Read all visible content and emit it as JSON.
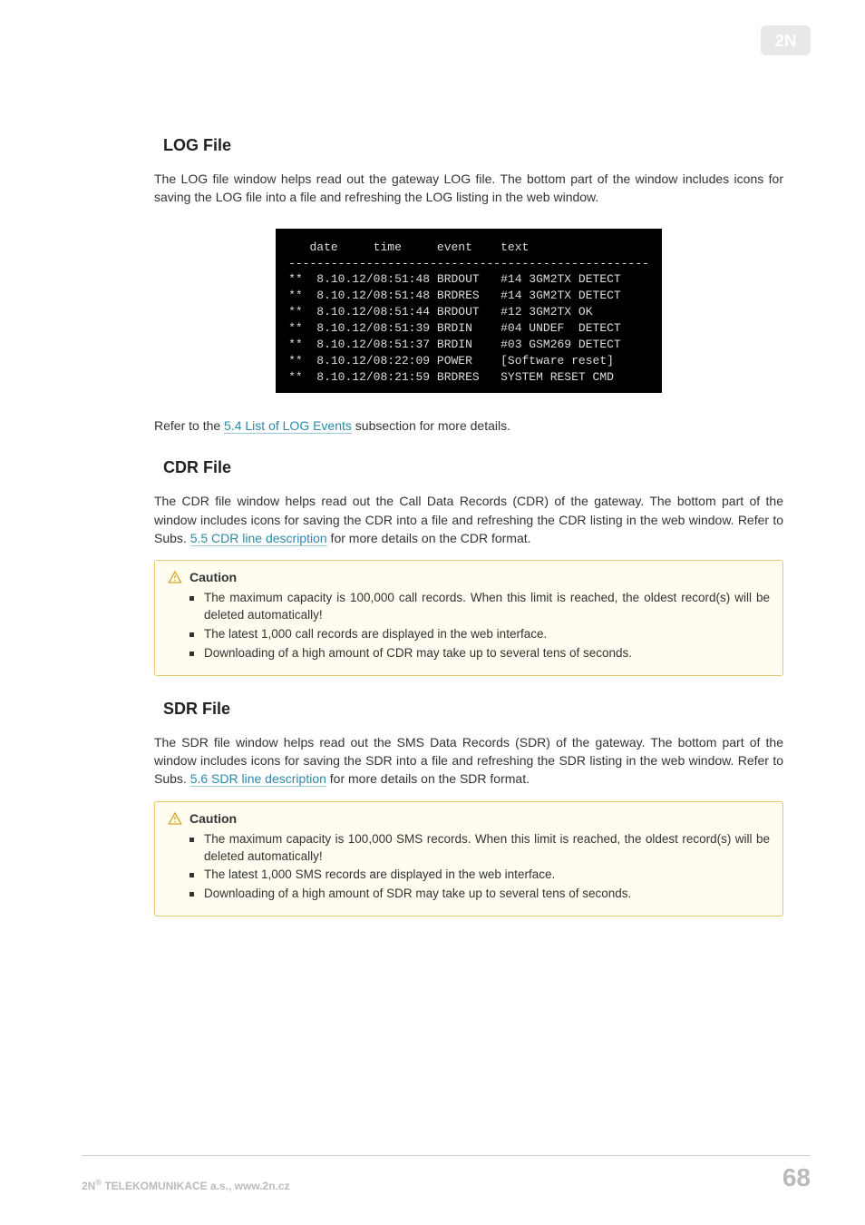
{
  "logo_alt": "2N",
  "sections": {
    "log": {
      "heading": "LOG File",
      "paragraph_before": "The LOG file window helps read out the gateway LOG file. The bottom part of the window includes icons for saving the LOG file into a file and refreshing the LOG listing in the web window.",
      "terminal_header": "   date     time     event    text",
      "terminal_divider": "---------------------------------------------------",
      "terminal_rows": [
        "**  8.10.12/08:51:48 BRDOUT   #14 3GM2TX DETECT",
        "**  8.10.12/08:51:48 BRDRES   #14 3GM2TX DETECT",
        "**  8.10.12/08:51:44 BRDOUT   #12 3GM2TX OK",
        "**  8.10.12/08:51:39 BRDIN    #04 UNDEF  DETECT",
        "**  8.10.12/08:51:37 BRDIN    #03 GSM269 DETECT",
        "**  8.10.12/08:22:09 POWER    [Software reset]",
        "**  8.10.12/08:21:59 BRDRES   SYSTEM RESET CMD"
      ],
      "after_prefix": "Refer to the ",
      "after_link": "5.4 List of LOG Events",
      "after_suffix": " subsection for more details."
    },
    "cdr": {
      "heading": "CDR File",
      "para_prefix": "The CDR file window helps read out the Call Data Records (CDR) of the gateway. The bottom part of the window includes icons for saving the CDR into a file and refreshing the CDR listing in the web window. Refer to Subs. ",
      "para_link": "5.5 CDR line description",
      "para_suffix": "  for more details on the CDR format.",
      "caution_label": "Caution",
      "caution_items": [
        "The maximum capacity is 100,000 call records. When this limit is reached, the oldest record(s) will be deleted automatically!",
        "The latest 1,000 call records are displayed in the web interface.",
        "Downloading of a high amount of CDR may take up to several tens of seconds."
      ]
    },
    "sdr": {
      "heading": "SDR File",
      "para_prefix": "The SDR file window helps read out the SMS Data Records (SDR) of the gateway. The bottom part of the window includes icons for saving the SDR into a file and refreshing the SDR listing in the web window. Refer to Subs. ",
      "para_link": "5.6 SDR line description",
      "para_suffix": " for more details on the SDR format.",
      "caution_label": "Caution",
      "caution_items": [
        "The maximum capacity is 100,000 SMS records. When this limit is reached, the oldest record(s) will be deleted automatically!",
        "The latest 1,000 SMS records are displayed in the web interface.",
        "Downloading of a high amount of SDR may take up to several tens of seconds."
      ]
    }
  },
  "footer": {
    "company_prefix": "2N",
    "company_sup": "®",
    "company_suffix": " TELEKOMUNIKACE a.s., www.2n.cz",
    "page": "68"
  }
}
